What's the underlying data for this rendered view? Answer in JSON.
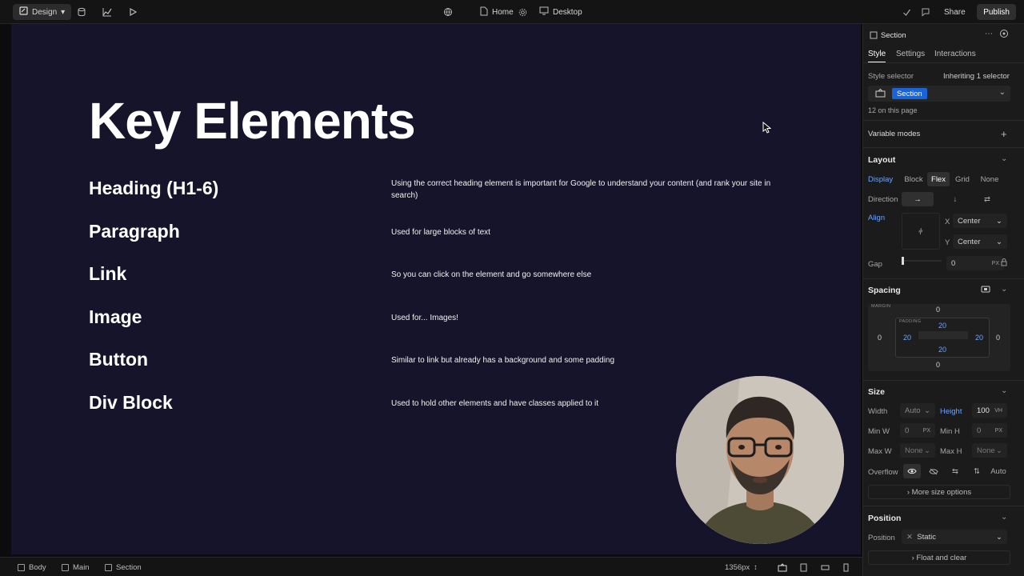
{
  "topbar": {
    "mode_label": "Design",
    "page_label": "Home",
    "breakpoint_label": "Desktop",
    "share_label": "Share",
    "publish_label": "Publish"
  },
  "canvas": {
    "title": "Key Elements",
    "rows": [
      {
        "title": "Heading (H1-6)",
        "desc": "Using the correct heading element is important for Google to understand your content (and rank your site in search)"
      },
      {
        "title": "Paragraph",
        "desc": "Used for large blocks of text"
      },
      {
        "title": "Link",
        "desc": "So you can click on the element and go somewhere else"
      },
      {
        "title": "Image",
        "desc": "Used for... Images!"
      },
      {
        "title": "Button",
        "desc": "Similar to link but already has a background and some padding"
      },
      {
        "title": "Div Block",
        "desc": "Used to hold other elements and have classes applied to it"
      }
    ]
  },
  "bottombar": {
    "breadcrumbs": [
      "Body",
      "Main",
      "Section"
    ],
    "width_readout": "1356px"
  },
  "panel": {
    "element_label": "Section",
    "tabs": [
      "Style",
      "Settings",
      "Interactions"
    ],
    "style_selector_label": "Style selector",
    "inheriting_label": "Inheriting 1 selector",
    "selector_chip": "Section",
    "on_page_label": "12 on this page",
    "variable_modes_label": "Variable modes",
    "layout": {
      "heading": "Layout",
      "display_label": "Display",
      "display_options": [
        "Block",
        "Flex",
        "Grid",
        "None"
      ],
      "display_selected": "Flex",
      "direction_label": "Direction",
      "align_label": "Align",
      "align_x_label": "X",
      "align_x_value": "Center",
      "align_y_label": "Y",
      "align_y_value": "Center",
      "gap_label": "Gap",
      "gap_value": "0",
      "gap_unit": "PX"
    },
    "spacing": {
      "heading": "Spacing",
      "margin_label": "MARGIN",
      "padding_label": "PADDING",
      "margin_top": "0",
      "margin_right": "0",
      "margin_bottom": "0",
      "margin_left": "0",
      "padding_top": "20",
      "padding_right": "20",
      "padding_bottom": "20",
      "padding_left": "20"
    },
    "size": {
      "heading": "Size",
      "width_label": "Width",
      "width_value": "Auto",
      "height_label": "Height",
      "height_value": "100",
      "height_unit": "VH",
      "minw_label": "Min W",
      "minw_value": "0",
      "minw_unit": "PX",
      "minh_label": "Min H",
      "minh_value": "0",
      "minh_unit": "PX",
      "maxw_label": "Max W",
      "maxw_value": "None",
      "maxh_label": "Max H",
      "maxh_value": "None",
      "overflow_label": "Overflow",
      "overflow_auto": "Auto",
      "more_label": "More size options"
    },
    "position": {
      "heading": "Position",
      "position_label": "Position",
      "position_value": "Static",
      "float_label": "Float and clear"
    }
  }
}
